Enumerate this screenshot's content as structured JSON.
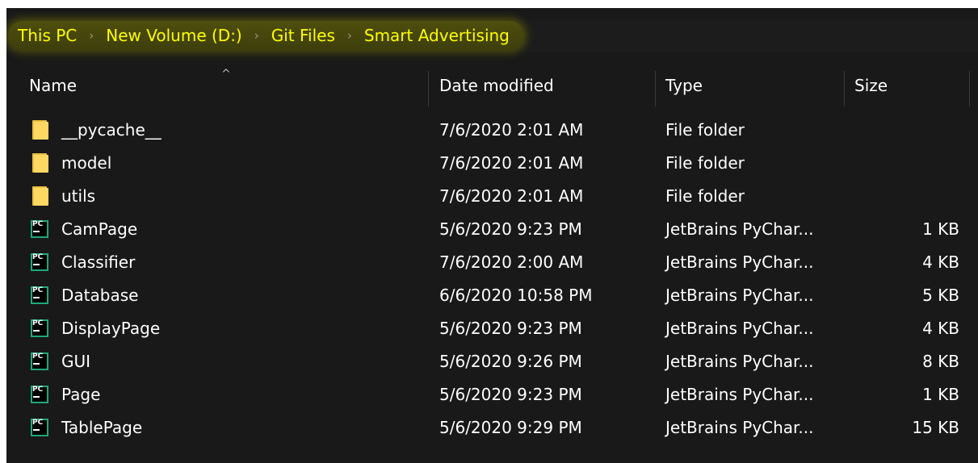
{
  "breadcrumb": {
    "items": [
      "This PC",
      "New Volume (D:)",
      "Git Files",
      "Smart Advertising"
    ],
    "separator": "›",
    "highlight_color": "#ffff00"
  },
  "columns": {
    "name": "Name",
    "date": "Date modified",
    "type": "Type",
    "size": "Size",
    "sort_indicator": "^"
  },
  "files": [
    {
      "name": "__pycache__",
      "date": "7/6/2020 2:01 AM",
      "type": "File folder",
      "size": "",
      "icon": "folder-icon"
    },
    {
      "name": "model",
      "date": "7/6/2020 2:01 AM",
      "type": "File folder",
      "size": "",
      "icon": "folder-icon"
    },
    {
      "name": "utils",
      "date": "7/6/2020 2:01 AM",
      "type": "File folder",
      "size": "",
      "icon": "folder-icon"
    },
    {
      "name": "CamPage",
      "date": "5/6/2020 9:23 PM",
      "type": "JetBrains PyChar...",
      "size": "1 KB",
      "icon": "pycharm-file-icon"
    },
    {
      "name": "Classifier",
      "date": "7/6/2020 2:00 AM",
      "type": "JetBrains PyChar...",
      "size": "4 KB",
      "icon": "pycharm-file-icon"
    },
    {
      "name": "Database",
      "date": "6/6/2020 10:58 PM",
      "type": "JetBrains PyChar...",
      "size": "5 KB",
      "icon": "pycharm-file-icon"
    },
    {
      "name": "DisplayPage",
      "date": "5/6/2020 9:23 PM",
      "type": "JetBrains PyChar...",
      "size": "4 KB",
      "icon": "pycharm-file-icon"
    },
    {
      "name": "GUI",
      "date": "5/6/2020 9:26 PM",
      "type": "JetBrains PyChar...",
      "size": "8 KB",
      "icon": "pycharm-file-icon"
    },
    {
      "name": "Page",
      "date": "5/6/2020 9:23 PM",
      "type": "JetBrains PyChar...",
      "size": "1 KB",
      "icon": "pycharm-file-icon"
    },
    {
      "name": "TablePage",
      "date": "5/6/2020 9:29 PM",
      "type": "JetBrains PyChar...",
      "size": "15 KB",
      "icon": "pycharm-file-icon"
    }
  ],
  "pycharm_icon_label": "PC",
  "colors": {
    "background": "#191919",
    "text": "#ffffff",
    "folder": "#ffd864",
    "pycharm_border": "#1fa87a"
  }
}
